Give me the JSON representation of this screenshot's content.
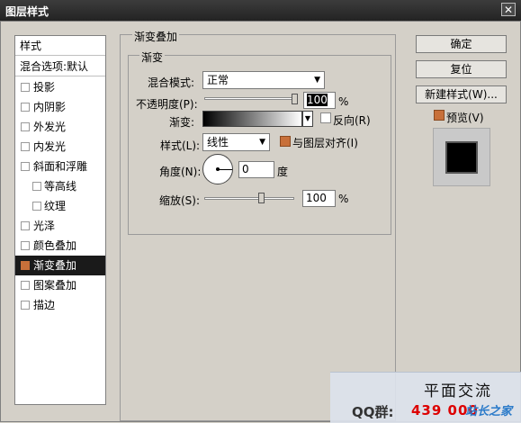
{
  "window": {
    "title": "图层样式",
    "close_glyph": "✕"
  },
  "style_list": {
    "header": "样式",
    "blend_default": "混合选项:默认",
    "items": [
      {
        "label": "投影",
        "checked": false,
        "sub": false
      },
      {
        "label": "内阴影",
        "checked": false,
        "sub": false
      },
      {
        "label": "外发光",
        "checked": false,
        "sub": false
      },
      {
        "label": "内发光",
        "checked": false,
        "sub": false
      },
      {
        "label": "斜面和浮雕",
        "checked": false,
        "sub": false
      },
      {
        "label": "等高线",
        "checked": false,
        "sub": true
      },
      {
        "label": "纹理",
        "checked": false,
        "sub": true
      },
      {
        "label": "光泽",
        "checked": false,
        "sub": false
      },
      {
        "label": "颜色叠加",
        "checked": false,
        "sub": false
      },
      {
        "label": "渐变叠加",
        "checked": true,
        "sub": false,
        "selected": true
      },
      {
        "label": "图案叠加",
        "checked": false,
        "sub": false
      },
      {
        "label": "描边",
        "checked": false,
        "sub": false
      }
    ]
  },
  "gradient_overlay": {
    "group_title": "渐变叠加",
    "sub_group_title": "渐变",
    "blend_mode_label": "混合模式:",
    "blend_mode_value": "正常",
    "opacity_label": "不透明度(P):",
    "opacity_value": "100",
    "opacity_unit": "%",
    "gradient_label": "渐变:",
    "reverse_label": "反向(R)",
    "style_label": "样式(L):",
    "style_value": "线性",
    "align_label": "与图层对齐(I)",
    "angle_label": "角度(N):",
    "angle_value": "0",
    "angle_unit": "度",
    "scale_label": "缩放(S):",
    "scale_value": "100",
    "scale_unit": "%",
    "opacity_fraction": 1.0,
    "scale_fraction": 0.5,
    "align_checked": true,
    "reverse_checked": false
  },
  "buttons": {
    "ok": "确定",
    "reset": "复位",
    "new_style": "新建样式(W)...",
    "preview": "预览(V)"
  },
  "watermark": {
    "title": "平面交流",
    "qq_label": "QQ群:",
    "qq_number": "439 000",
    "logo_text": "站长之家"
  },
  "colors": {
    "accent_orange": "#c8703a",
    "selected_bg": "#1a1a1a"
  }
}
